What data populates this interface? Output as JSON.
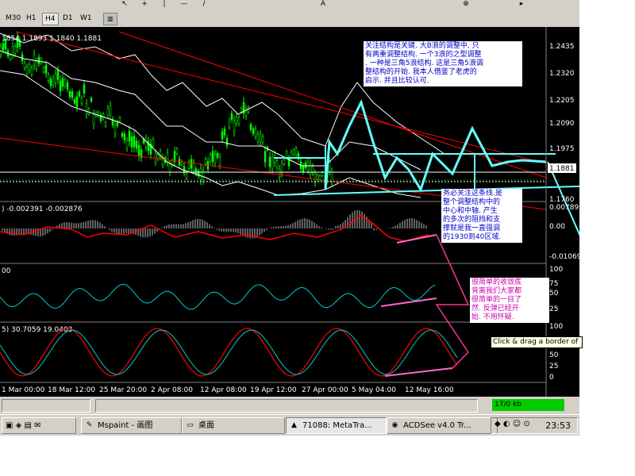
{
  "timeframes": [
    "M30",
    "H1",
    "H4",
    "D1",
    "W1"
  ],
  "active_timeframe": "H4",
  "chart": {
    "ohlc": "1854 1.1893 1.1840 1.1881",
    "price_ticks": [
      "1.2435",
      "1.2320",
      "1.2205",
      "1.2090",
      "1.1975",
      "1.1760"
    ],
    "current_price": "1.1881",
    "macd_label": ") -0.002391 -0.002876",
    "macd_ticks": [
      "0.00789",
      "0.00",
      "-0.01069"
    ],
    "rsi_label": "00",
    "rsi_ticks": [
      "100",
      "75",
      "50",
      "25"
    ],
    "stoch_label": "5) 30.7059 19.0403",
    "stoch_ticks": [
      "100",
      "75",
      "50",
      "25",
      "0"
    ],
    "dates": [
      "1 Mar 00:00",
      "18 Mar 12:00",
      "25 Mar 20:00",
      "2 Apr 08:00",
      "12 Apr 08:00",
      "19 Apr 12:00",
      "27 Apr 00:00",
      "5 May 04:00",
      "12 May 16:00"
    ]
  },
  "notes": {
    "note1": "关注结构是关键. 大B浪的调整中, 只\n有两重调整结构. 一个3浪的之型调整\n. 一种是三角5浪结构. 这是三角5浪调\n整结构的开始. 我本人借鉴了老虎的\n启示. 并且比较认可.",
    "note2": "务必关注这条线.是\n整个调整结构中的\n中心和中轴. 产生\n的多次的阻挡和支\n撑就是我一直强调\n的1930到40区域.",
    "note3": "很简单的收敛底\n背离我们大家都\n很简单的一目了\n然. 反弹已经开\n始. 不用怀疑."
  },
  "tooltip": "Click & drag a border of",
  "status_net": "17/0 kb",
  "taskbar": {
    "items": [
      "Mspaint - 画图",
      "桌面",
      "71088: MetaTra...",
      "ACDSee v4.0 Tr..."
    ],
    "clock": "23:53"
  },
  "colors": {
    "candle_up": "#00ff00",
    "bands": "#ffffff",
    "trendline": "#ff0000",
    "wave": "#66ffff",
    "notes_pink": "#cc00aa"
  }
}
